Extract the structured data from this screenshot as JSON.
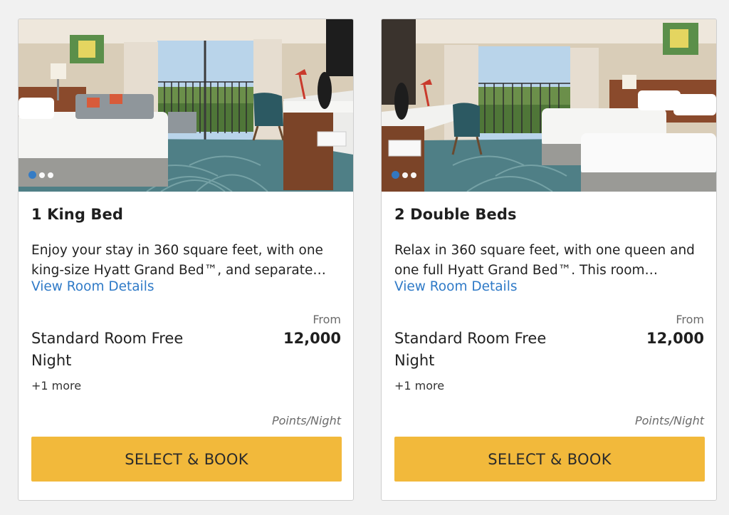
{
  "rooms": [
    {
      "title": "1 King Bed",
      "description": "Enjoy your stay in 360 square feet, with one\nking-size Hyatt Grand Bed™, and separate…",
      "details_link": "View Room Details",
      "from_label": "From",
      "price": "12,000",
      "rate_name": "Standard Room Free Night",
      "more": "+1 more",
      "unit": "Points/Night",
      "button": "SELECT & BOOK",
      "carousel": {
        "total": 3,
        "active": 1
      }
    },
    {
      "title": "2 Double Beds",
      "description": "Relax in 360 square feet, with one queen and\none full Hyatt Grand Bed™. This room…",
      "details_link": "View Room Details",
      "from_label": "From",
      "price": "12,000",
      "rate_name": "Standard Room Free Night",
      "more": "+1 more",
      "unit": "Points/Night",
      "button": "SELECT & BOOK",
      "carousel": {
        "total": 3,
        "active": 1
      }
    }
  ],
  "colors": {
    "accent_link": "#2f7ac7",
    "button_bg": "#f2b93b",
    "page_bg": "#f1f1f1"
  }
}
